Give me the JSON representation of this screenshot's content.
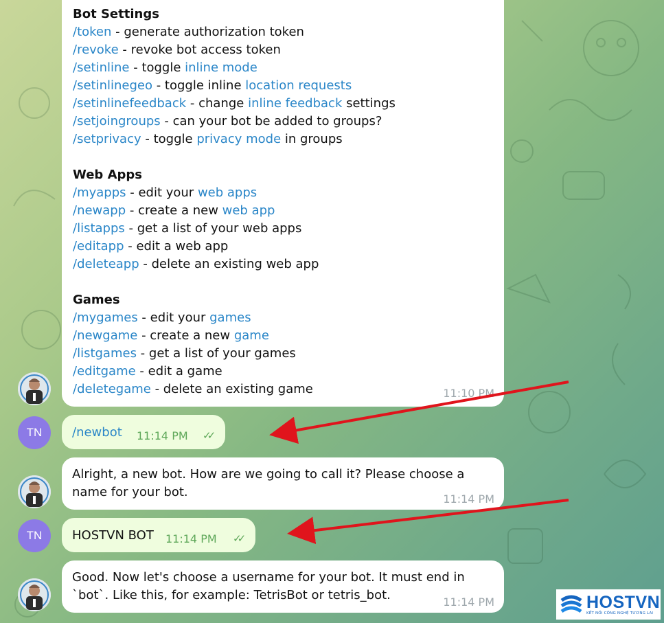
{
  "commands_message": {
    "sections": [
      {
        "title": "Bot Settings",
        "lines": [
          [
            {
              "t": "/token",
              "link": true
            },
            {
              "t": " - generate authorization token"
            }
          ],
          [
            {
              "t": "/revoke",
              "link": true
            },
            {
              "t": " - revoke bot access token"
            }
          ],
          [
            {
              "t": "/setinline",
              "link": true
            },
            {
              "t": " - toggle "
            },
            {
              "t": "inline mode",
              "link": true
            }
          ],
          [
            {
              "t": "/setinlinegeo",
              "link": true
            },
            {
              "t": " - toggle inline "
            },
            {
              "t": "location requests",
              "link": true
            }
          ],
          [
            {
              "t": "/setinlinefeedback",
              "link": true
            },
            {
              "t": " - change "
            },
            {
              "t": "inline feedback",
              "link": true
            },
            {
              "t": " settings"
            }
          ],
          [
            {
              "t": "/setjoingroups",
              "link": true
            },
            {
              "t": " - can your bot be added to groups?"
            }
          ],
          [
            {
              "t": "/setprivacy",
              "link": true
            },
            {
              "t": " - toggle "
            },
            {
              "t": "privacy mode",
              "link": true
            },
            {
              "t": " in groups"
            }
          ]
        ]
      },
      {
        "title": "Web Apps",
        "lines": [
          [
            {
              "t": "/myapps",
              "link": true
            },
            {
              "t": " - edit your "
            },
            {
              "t": "web apps",
              "link": true
            }
          ],
          [
            {
              "t": "/newapp",
              "link": true
            },
            {
              "t": " - create a new "
            },
            {
              "t": "web app",
              "link": true
            }
          ],
          [
            {
              "t": "/listapps",
              "link": true
            },
            {
              "t": " - get a list of your web apps"
            }
          ],
          [
            {
              "t": "/editapp",
              "link": true
            },
            {
              "t": " - edit a web app"
            }
          ],
          [
            {
              "t": "/deleteapp",
              "link": true
            },
            {
              "t": " - delete an existing web app"
            }
          ]
        ]
      },
      {
        "title": "Games",
        "lines": [
          [
            {
              "t": "/mygames",
              "link": true
            },
            {
              "t": " - edit your "
            },
            {
              "t": "games",
              "link": true
            }
          ],
          [
            {
              "t": "/newgame",
              "link": true
            },
            {
              "t": " - create a new "
            },
            {
              "t": "game",
              "link": true
            }
          ],
          [
            {
              "t": "/listgames",
              "link": true
            },
            {
              "t": " - get a list of your games"
            }
          ],
          [
            {
              "t": "/editgame",
              "link": true
            },
            {
              "t": " - edit a game"
            }
          ],
          [
            {
              "t": "/deletegame",
              "link": true
            },
            {
              "t": " - delete an existing game"
            }
          ]
        ]
      }
    ],
    "time": "11:10 PM"
  },
  "messages": {
    "newbot": {
      "text": "/newbot",
      "time": "11:14 PM",
      "avatar": "TN"
    },
    "reply1": {
      "line1": "Alright, a new bot. How are we going to call it? Please choose a",
      "line2": "name for your bot.",
      "time": "11:14 PM"
    },
    "hostvn": {
      "text": "HOSTVN BOT",
      "time": "11:14 PM",
      "avatar": "TN"
    },
    "reply2": {
      "line1": "Good. Now let's choose a username for your bot. It must end in",
      "line2": "`bot`. Like this, for example: TetrisBot or tetris_bot.",
      "time": "11:14 PM"
    }
  },
  "watermark": {
    "name": "HOSTVN",
    "tagline": "KẾT NỐI CÔNG NGHỆ TƯƠNG LAI"
  },
  "colors": {
    "link": "#2a86c8",
    "outgoing_bubble": "#effdde",
    "time_out": "#5fa85a",
    "avatar_tn": "#8c7ae6",
    "arrow": "#e0141c"
  },
  "icons": {
    "read_receipt": "double-check-icon",
    "bot_avatar": "bot-avatar-photo"
  }
}
